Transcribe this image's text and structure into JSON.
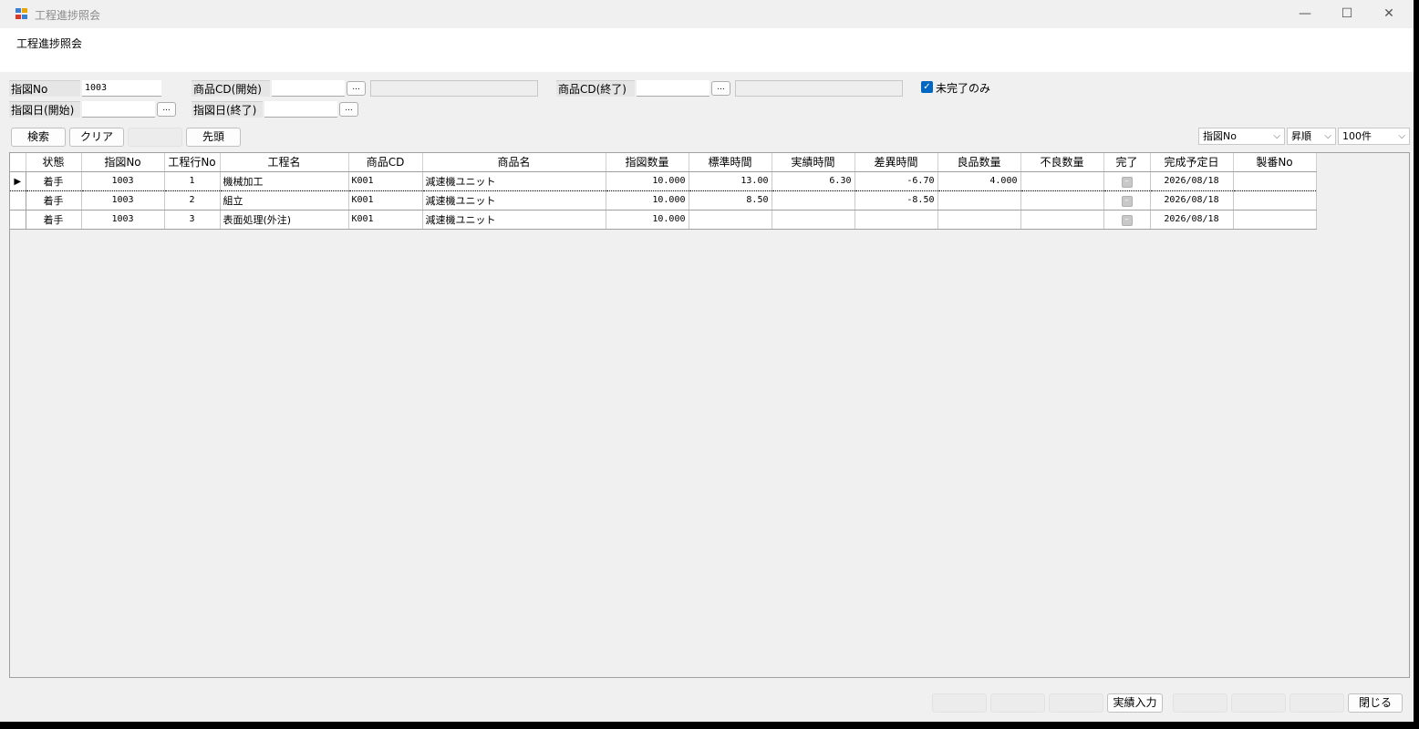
{
  "window": {
    "title": "工程進捗照会",
    "minimize_glyph": "—",
    "maximize_glyph": "☐",
    "close_glyph": "✕"
  },
  "form_title": "工程進捗照会",
  "filters": {
    "shizu_no_label": "指図No",
    "shizu_no_value": "1003",
    "shohin_cd_start_label": "商品CD(開始)",
    "shohin_cd_start_value": "",
    "shohin_cd_end_label": "商品CD(終了)",
    "shohin_cd_end_value": "",
    "shizu_date_start_label": "指図日(開始)",
    "shizu_date_start_value": "",
    "shizu_date_end_label": "指図日(終了)",
    "shizu_date_end_value": "",
    "ellipsis": "...",
    "incomplete_only_label": "未完了のみ",
    "incomplete_only_checked": true
  },
  "buttons": {
    "search": "検索",
    "clear": "クリア",
    "top": "先頭",
    "jisseki_input": "実績入力",
    "close": "閉じる"
  },
  "sort": {
    "field": "指図No",
    "order": "昇順",
    "limit": "100件",
    "arrow": "⌵"
  },
  "grid": {
    "columns": [
      "状態",
      "指図No",
      "工程行No",
      "工程名",
      "商品CD",
      "商品名",
      "指図数量",
      "標準時間",
      "実績時間",
      "差異時間",
      "良品数量",
      "不良数量",
      "完了",
      "完成予定日",
      "製番No"
    ],
    "current_row_marker": "▶",
    "complete_glyph": "–",
    "rows": [
      {
        "status": "着手",
        "shizu_no": "1003",
        "gyo_no": "1",
        "koutei": "機械加工",
        "shohin_cd": "K001",
        "shohin_mei": "減速機ユニット",
        "qty": "10.000",
        "std_time": "13.00",
        "act_time": "6.30",
        "diff_time": "-6.70",
        "good_qty": "4.000",
        "bad_qty": "",
        "done": false,
        "due": "2026/08/18",
        "seiban": ""
      },
      {
        "status": "着手",
        "shizu_no": "1003",
        "gyo_no": "2",
        "koutei": "組立",
        "shohin_cd": "K001",
        "shohin_mei": "減速機ユニット",
        "qty": "10.000",
        "std_time": "8.50",
        "act_time": "",
        "diff_time": "-8.50",
        "good_qty": "",
        "bad_qty": "",
        "done": false,
        "due": "2026/08/18",
        "seiban": ""
      },
      {
        "status": "着手",
        "shizu_no": "1003",
        "gyo_no": "3",
        "koutei": "表面処理(外注)",
        "shohin_cd": "K001",
        "shohin_mei": "減速機ユニット",
        "qty": "10.000",
        "std_time": "",
        "act_time": "",
        "diff_time": "",
        "good_qty": "",
        "bad_qty": "",
        "done": false,
        "due": "2026/08/18",
        "seiban": ""
      }
    ]
  }
}
